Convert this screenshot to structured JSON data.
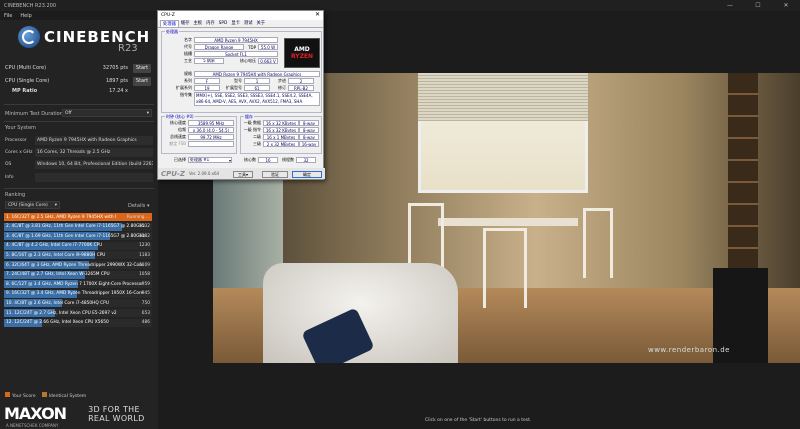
{
  "app": {
    "title": "CINEBENCH R23.200",
    "menu": [
      "File",
      "Help"
    ],
    "logo_text": "CINEBENCH",
    "version": "R23"
  },
  "scores": [
    {
      "label": "CPU (Multi Core)",
      "value": "32705 pts",
      "button": "Start"
    },
    {
      "label": "CPU (Single Core)",
      "value": "1897 pts",
      "button": "Start"
    },
    {
      "label": "MP Ratio",
      "value": "17.24 x"
    }
  ],
  "settings": {
    "min_duration_label": "Minimum Test Duration",
    "min_duration_value": "Off"
  },
  "system": {
    "title": "Your System",
    "rows": [
      {
        "k": "Processor",
        "v": "AMD Ryzen 9 7945HX with Radeon Graphics"
      },
      {
        "k": "Cores x GHz",
        "v": "16 Cores, 32 Threads @ 2.5 GHz"
      },
      {
        "k": "OS",
        "v": "Windows 10, 64 Bit, Professional Edition (build 22631)"
      },
      {
        "k": "Info",
        "v": ""
      }
    ]
  },
  "ranking": {
    "title": "Ranking",
    "mode": "CPU (Single Core)",
    "details": "Details",
    "items": [
      {
        "name": "1. 16C/32T @ 2.5 GHz, AMD Ryzen 9 7945HX with I",
        "score": "Running ...",
        "fill": 0.0,
        "me": true
      },
      {
        "name": "2. 4C/8T @ 3.81 GHz, 11th Gen Intel Core i7-1165G7 @ 2.80GHz",
        "score": "1532",
        "fill": 1.0
      },
      {
        "name": "3. 4C/8T @ 1.69 GHz, 11th Gen Intel Core i7-1165G7 @ 2.80GHz",
        "score": "1382",
        "fill": 0.9
      },
      {
        "name": "4. 4C/8T @ 4.2 GHz, Intel Core i7-7700K CPU",
        "score": "1230",
        "fill": 0.8
      },
      {
        "name": "5. 8C/16T @ 2.3 GHz, Intel Core i9-9880H CPU",
        "score": "1183",
        "fill": 0.77
      },
      {
        "name": "6. 32C/64T @ 3 GHz, AMD Ryzen Threadripper 2990WX 32-Core",
        "score": "1109",
        "fill": 0.72
      },
      {
        "name": "7. 24C/48T @ 2.7 GHz, Intel Xeon W-3265M CPU",
        "score": "1058",
        "fill": 0.69
      },
      {
        "name": "8. 6C/12T @ 3.4 GHz, AMD Ryzen 7 1700X Eight-Core Processor",
        "score": "959",
        "fill": 0.63
      },
      {
        "name": "9. 16C/32T @ 3.4 GHz, AMD Ryzen Threadripper 1950X 16-Core",
        "score": "945",
        "fill": 0.62
      },
      {
        "name": "10. 4C/8T @ 2.6 GHz, Intel Core i7-4850HQ CPU",
        "score": "750",
        "fill": 0.49
      },
      {
        "name": "11. 12C/24T @ 2.7 GHz, Intel Xeon CPU E5-2697 v2",
        "score": "653",
        "fill": 0.43
      },
      {
        "name": "12. 12C/24T @ 2.66 GHz, Intel Xeon CPU X5650",
        "score": "486",
        "fill": 0.32
      }
    ]
  },
  "legend": {
    "your": "Your Score",
    "identical": "Identical System",
    "your_color": "#d9661a",
    "identical_color": "#b07a2a"
  },
  "brand": {
    "maxon": "MAXON",
    "sub": "A NEMETSCHEK COMPANY",
    "tagline": "3D FOR THE REAL WORLD"
  },
  "render": {
    "watermark": "www.renderbaron.de"
  },
  "status_hint": "Click on one of the 'Start' buttons to run a test.",
  "cpuz": {
    "title": "CPU-Z",
    "tabs": [
      "处理器",
      "缓存",
      "主板",
      "内存",
      "SPD",
      "显卡",
      "测试",
      "关于"
    ],
    "processor_group": "处理器",
    "name_k": "名字",
    "name_v": "AMD Ryzen 9 7945HX",
    "code_k": "代号",
    "code_v": "Dragon Range",
    "tdp_k": "TDP",
    "tdp_v": "55.0 W",
    "socket_k": "插槽",
    "socket_v": "Socket FL1",
    "tech_k": "工艺",
    "tech_v": "5 纳米",
    "volt_k": "核心电压",
    "volt_v": "0.663 V",
    "spec_k": "规格",
    "spec_v": "AMD Ryzen 9 7945HX with Radeon Graphics",
    "family_k": "系列",
    "family_v": "F",
    "model_k": "型号",
    "model_v": "1",
    "step_k": "步进",
    "step_v": "2",
    "extfam_k": "扩展系列",
    "extfam_v": "19",
    "extmod_k": "扩展型号",
    "extmod_v": "61",
    "rev_k": "修订",
    "rev_v": "RPL-B2",
    "inst_k": "指令集",
    "inst_v": "MMX(+), SSE, SSE2, SSE3, SSSE3, SSE4.1, SSE4.2, SSE4A, x86-64, AMD-V, AES, AVX, AVX2, AVX512, FMA3, SHA",
    "clock_group": "时钟 (核心 #0)",
    "cache_group": "缓存",
    "core_k": "核心速度",
    "core_v": "3589.95 MHz",
    "mult_k": "倍频",
    "mult_v": "x 36.0 (4.0 - 54.5)",
    "bus_k": "总线速度",
    "bus_v": "99.72 MHz",
    "fsb_k": "额定 FSB",
    "l1d_k": "一级 数据",
    "l1d_v": "16 x 32 KBytes",
    "l1d_w": "8-way",
    "l1i_k": "一级 指令",
    "l1i_v": "16 x 32 KBytes",
    "l1i_w": "8-way",
    "l2_k": "二级",
    "l2_v": "16 x 1 MBytes",
    "l2_w": "8-way",
    "l3_k": "三级",
    "l3_v": "2 x 32 MBytes",
    "l3_w": "16-way",
    "sel_k": "已选择",
    "sel_v": "处理器 #1",
    "cores_k": "核心数",
    "cores_v": "16",
    "threads_k": "线程数",
    "threads_v": "32",
    "version": "Ver. 2.09.0.x64",
    "tools": "工具",
    "validate": "验证",
    "ok": "确定"
  }
}
